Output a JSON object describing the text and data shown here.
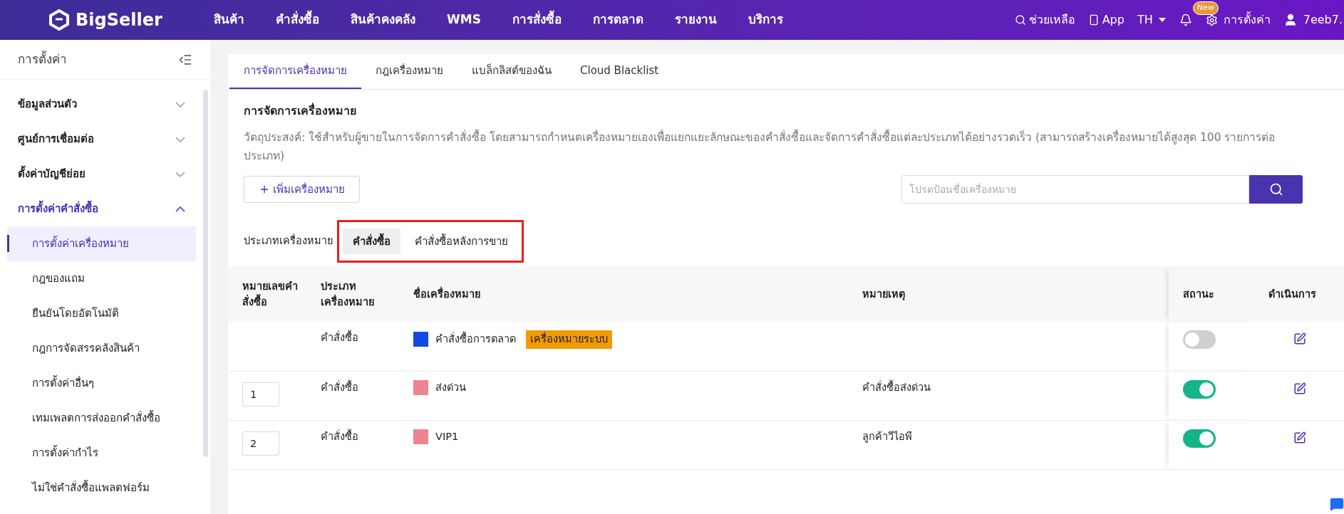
{
  "top_nav": {
    "logo": "BigSeller",
    "menu": [
      {
        "label": "สินค้า"
      },
      {
        "label": "คำสั่งซื้อ"
      },
      {
        "label": "สินค้าคงคลัง"
      },
      {
        "label": "WMS"
      },
      {
        "label": "การสั่งซื้อ"
      },
      {
        "label": "การตลาด"
      },
      {
        "label": "รายงาน"
      },
      {
        "label": "บริการ"
      }
    ],
    "help": "ช่วยเหลือ",
    "app": "App",
    "language": "TH",
    "badge": "New",
    "settings": "การตั้งค่า",
    "user": "7eeb7."
  },
  "sidebar": {
    "title": "การตั้งค่า",
    "groups": [
      {
        "label": "ข้อมูลส่วนตัว",
        "expanded": false
      },
      {
        "label": "ศูนย์การเชื่อมต่อ",
        "expanded": false
      },
      {
        "label": "ตั้งค่าบัญชีย่อย",
        "expanded": false
      },
      {
        "label": "การตั้งค่าคำสั่งซื้อ",
        "expanded": true,
        "children": [
          {
            "label": "การตั้งค่าเครื่องหมาย",
            "selected": true
          },
          {
            "label": "กฎของแถม",
            "selected": false
          },
          {
            "label": "ยืนยันโดยอัตโนมัติ",
            "selected": false
          },
          {
            "label": "กฎการจัดสรรคลังสินค้า",
            "selected": false
          },
          {
            "label": "การตั้งค่าอื่นๆ",
            "selected": false
          },
          {
            "label": "เทมเพลตการส่งออกคำสั่งซื้อ",
            "selected": false
          },
          {
            "label": "การตั้งค่ากำไร",
            "selected": false
          },
          {
            "label": "ไม่ใช่คำสั่งซื้อแพลตฟอร์ม",
            "selected": false
          }
        ]
      }
    ]
  },
  "tabs": [
    {
      "label": "การจัดการเครื่องหมาย",
      "selected": true
    },
    {
      "label": "กฎเครื่องหมาย",
      "selected": false
    },
    {
      "label": "แบล็กลิสต์ของฉัน",
      "selected": false
    },
    {
      "label": "Cloud Blacklist",
      "selected": false
    }
  ],
  "section": {
    "title": "การจัดการเครื่องหมาย",
    "description": "วัตถุประสงค์: ใช้สำหรับผู้ขายในการจัดการคำสั่งซื้อ โดยสามารถกำหนดเครื่องหมายเองเพื่อแยกแยะลักษณะของคำสั่งซื้อและจัดการคำสั่งซื้อแต่ละประเภทได้อย่างรวดเร็ว (สามารถสร้างเครื่องหมายได้สูงสุด 100 รายการต่อประเภท)",
    "add_button": "เพิ่มเครื่องหมาย",
    "search_placeholder": "โปรดป้อนชื่อเครื่องหมาย"
  },
  "type_filter": {
    "label": "ประเภทเครื่องหมาย",
    "highlighted": true,
    "options": [
      {
        "label": "คำสั่งซื้อ",
        "selected": true
      },
      {
        "label": "คำสั่งซื้อหลังการขาย",
        "selected": false
      }
    ]
  },
  "table": {
    "columns": [
      "หมายเลขคำสั่งซื้อ",
      "ประเภทเครื่องหมาย",
      "ชื่อเครื่องหมาย",
      "หมายเหตุ",
      "สถานะ",
      "ดำเนินการ"
    ],
    "rows": [
      {
        "type": "คำสั่งซื้อ",
        "color": "#1446e6",
        "name": "คำสั่งซื้อการตลาด",
        "badge": "เครื่องหมายระบบ",
        "on": false
      },
      {
        "number": "1",
        "type": "คำสั่งซื้อ",
        "color": "#ec8590",
        "name": "ส่งด่วน",
        "note": "คำสั่งซื้อส่งด่วน",
        "on": true
      },
      {
        "number": "2",
        "type": "คำสั่งซื้อ",
        "color": "#ec8590",
        "name": "VIP1",
        "note": "ลูกค้าวีไอพี",
        "on": true
      }
    ]
  }
}
